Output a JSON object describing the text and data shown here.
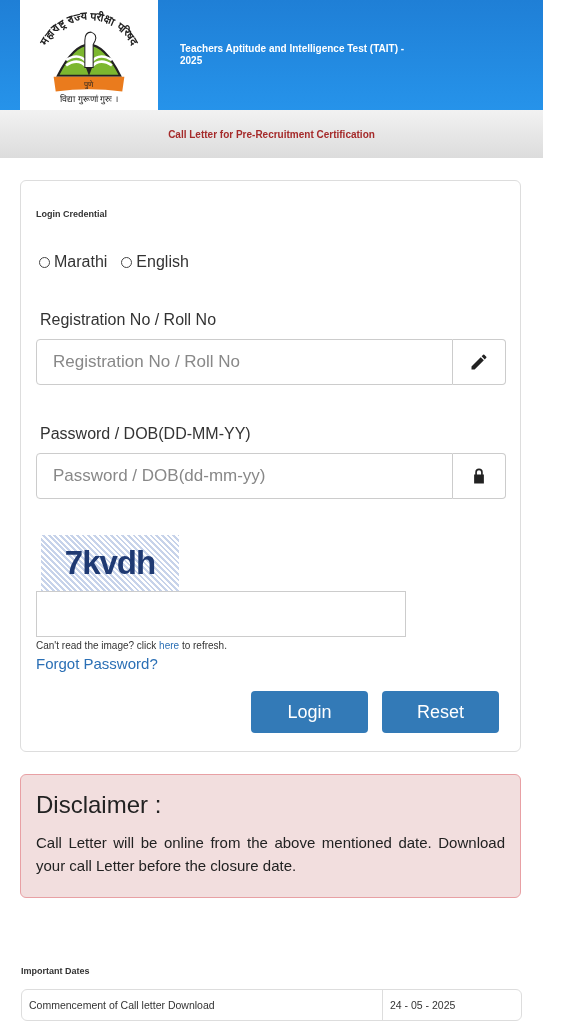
{
  "header": {
    "logo": {
      "arc_text": "महाराष्ट्र राज्य परीक्षा परिषद",
      "city": "पुणे",
      "motto": "विद्या गुरूणां गुरुः ।"
    },
    "title": "Teachers Aptitude and Intelligence Test (TAIT) - 2025"
  },
  "subtitle": "Call Letter for Pre-Recruitment Certification",
  "login": {
    "heading": "Login Credential",
    "languages": [
      {
        "label": "Marathi",
        "selected": false
      },
      {
        "label": "English",
        "selected": false
      }
    ],
    "fields": [
      {
        "label": "Registration No / Roll No",
        "placeholder": "Registration No / Roll No",
        "kind": "text"
      },
      {
        "label": "Password / DOB(DD-MM-YY)",
        "placeholder": "Password / DOB(dd-mm-yy)",
        "kind": "password"
      }
    ],
    "captcha": "7kvdh",
    "refresh_note": {
      "before": "Can't read the image? click",
      "link": "here",
      "after": "to refresh."
    },
    "forgot_link": "Forgot Password?",
    "buttons": [
      "Login",
      "Reset"
    ]
  },
  "disclaimer": {
    "title": "Disclaimer :",
    "text": "Call Letter will be online from the above mentioned date. Download your call Letter before the closure date."
  },
  "important_dates": {
    "heading": "Important Dates",
    "rows": [
      {
        "event": "Commencement of Call letter Download",
        "date": "24 - 05 - 2025"
      }
    ]
  }
}
